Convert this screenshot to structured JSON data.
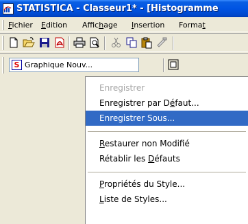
{
  "window": {
    "title": "STATISTICA - Classeur1* - [Histogramme"
  },
  "menubar": {
    "items": [
      {
        "pre": "",
        "u": "F",
        "post": "ichier"
      },
      {
        "pre": "",
        "u": "E",
        "post": "dition"
      },
      {
        "pre": "Affic",
        "u": "h",
        "post": "age"
      },
      {
        "pre": "",
        "u": "I",
        "post": "nsertion"
      },
      {
        "pre": "Forma",
        "u": "t",
        "post": ""
      }
    ]
  },
  "toolbar": {
    "icons": [
      "new-document-icon",
      "open-folder-icon",
      "save-icon",
      "pdf-icon",
      "print-icon",
      "print-preview-icon",
      "cut-icon",
      "copy-icon",
      "paste-icon",
      "format-painter-icon"
    ]
  },
  "style_toolbar": {
    "combo_value": "Graphique Nouv..."
  },
  "context_menu": {
    "items": [
      {
        "pre": "Enregistrer",
        "u": "",
        "post": "",
        "state": "disabled"
      },
      {
        "pre": "Enregistrer par D",
        "u": "é",
        "post": "faut...",
        "state": "normal"
      },
      {
        "pre": "Enregistrer Sous...",
        "u": "",
        "post": "",
        "state": "selected"
      },
      {
        "pre": "",
        "u": "R",
        "post": "estaurer non Modifié",
        "state": "normal"
      },
      {
        "pre": "Rétablir les ",
        "u": "D",
        "post": "éfauts",
        "state": "normal"
      },
      {
        "pre": "",
        "u": "P",
        "post": "ropriétés du Style...",
        "state": "normal"
      },
      {
        "pre": "",
        "u": "L",
        "post": "iste de Styles...",
        "state": "normal"
      }
    ]
  },
  "colors": {
    "title_bar": "#0054e3",
    "selection": "#316ac5",
    "disabled_text": "#a5a5a5"
  }
}
